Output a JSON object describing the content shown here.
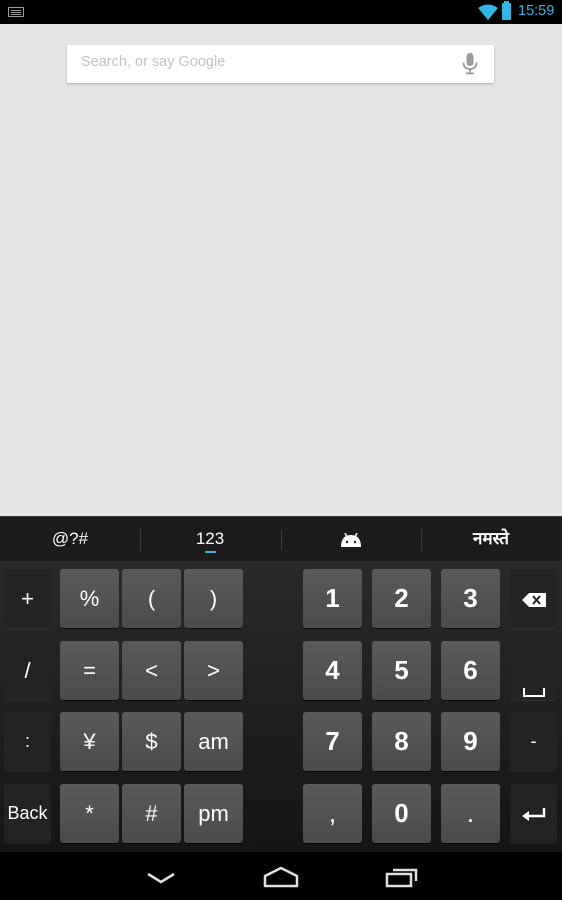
{
  "status_bar": {
    "time": "15:59",
    "icons": [
      "keyboard-notification-icon",
      "wifi-icon",
      "battery-icon"
    ],
    "accent_color": "#33b5e5"
  },
  "search": {
    "placeholder": "Search, or say Google",
    "value": "",
    "icon": "mic-icon"
  },
  "keyboard": {
    "tabs": [
      {
        "label": "@?#",
        "selected": false
      },
      {
        "label": "123",
        "selected": true
      },
      {
        "label": "",
        "icon": "android-icon",
        "selected": false
      },
      {
        "label": "नमस्ते",
        "selected": false
      }
    ],
    "left_column": [
      "+",
      "/",
      ":",
      "Back"
    ],
    "symbols": [
      [
        "%",
        "(",
        ")"
      ],
      [
        "=",
        "<",
        ">"
      ],
      [
        "¥",
        "$",
        "am"
      ],
      [
        "*",
        "#",
        "pm"
      ]
    ],
    "numpad": [
      [
        "1",
        "2",
        "3"
      ],
      [
        "4",
        "5",
        "6"
      ],
      [
        "7",
        "8",
        "9"
      ],
      [
        ",",
        "0",
        "."
      ]
    ],
    "right_column": [
      "backspace-icon",
      "space-icon",
      "-",
      "enter-icon"
    ],
    "right_labels": {
      "minus": "-"
    }
  },
  "nav_bar": {
    "icons": [
      "back-icon",
      "home-icon",
      "recent-apps-icon"
    ]
  }
}
